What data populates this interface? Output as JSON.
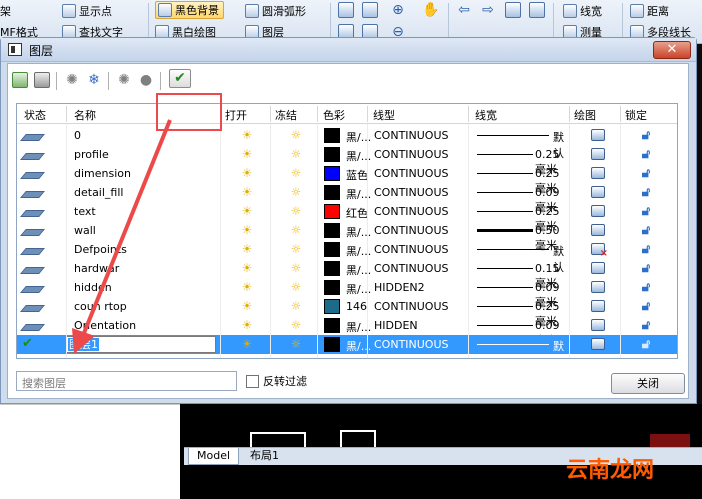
{
  "ribbon": {
    "items": [
      "架",
      "显示点",
      "MF格式",
      "查找文字",
      "黑色背景",
      "圆滑弧形",
      "黑白绘图",
      "图层",
      "线宽",
      "测量",
      "距离",
      "多段线长"
    ]
  },
  "dialog": {
    "title": "图层",
    "close_label": "✕",
    "apply_label": "✔",
    "columns": [
      "状态",
      "名称",
      "打开",
      "冻结",
      "色彩",
      "线型",
      "线宽",
      "绘图",
      "锁定"
    ],
    "layers": [
      {
        "name": "0",
        "color_name": "黑/...",
        "color": "#000000",
        "linetype": "CONTINUOUS",
        "lineweight": "默认",
        "plot": true
      },
      {
        "name": "profile",
        "color_name": "黑/...",
        "color": "#000000",
        "linetype": "CONTINUOUS",
        "lineweight": "0.25 毫米",
        "plot": true
      },
      {
        "name": "dimension",
        "color_name": "蓝色",
        "color": "#0000ff",
        "linetype": "CONTINUOUS",
        "lineweight": "0.25 毫米",
        "plot": true
      },
      {
        "name": "detail_fill",
        "color_name": "黑/...",
        "color": "#000000",
        "linetype": "CONTINUOUS",
        "lineweight": "0.09 毫米",
        "plot": true
      },
      {
        "name": "text",
        "color_name": "红色",
        "color": "#ff0000",
        "linetype": "CONTINUOUS",
        "lineweight": "0.25 毫米",
        "plot": true
      },
      {
        "name": "wall",
        "color_name": "黑/...",
        "color": "#000000",
        "linetype": "CONTINUOUS",
        "lineweight": "0.50 毫米",
        "plot": true
      },
      {
        "name": "Defpoints",
        "color_name": "黑/...",
        "color": "#000000",
        "linetype": "CONTINUOUS",
        "lineweight": "默认",
        "plot": false
      },
      {
        "name": "hardwar",
        "color_name": "黑/...",
        "color": "#000000",
        "linetype": "CONTINUOUS",
        "lineweight": "0.15 毫米",
        "plot": true
      },
      {
        "name": "hidden",
        "color_name": "黑/...",
        "color": "#000000",
        "linetype": "HIDDEN2",
        "lineweight": "0.09 毫米",
        "plot": true
      },
      {
        "name": "coun  rtop",
        "color_name": "146",
        "color": "#1c6b8a",
        "linetype": "CONTINUOUS",
        "lineweight": "0.25 毫米",
        "plot": true
      },
      {
        "name": "Orientation",
        "color_name": "黑/...",
        "color": "#000000",
        "linetype": "HIDDEN",
        "lineweight": "0.09 毫米",
        "plot": true
      }
    ],
    "new_layer": {
      "name": "图层1",
      "color_name": "黑/...",
      "color": "#000000",
      "linetype": "CONTINUOUS",
      "lineweight": "默认"
    },
    "search_placeholder": "搜索图层",
    "invert_filter_label": "反转过滤",
    "close_button_label": "关闭"
  },
  "tabs": [
    "Model",
    "布局1"
  ],
  "watermark": "云南龙网",
  "colors": {
    "accent": "#3399ff",
    "highlight": "#ec4a4a"
  }
}
